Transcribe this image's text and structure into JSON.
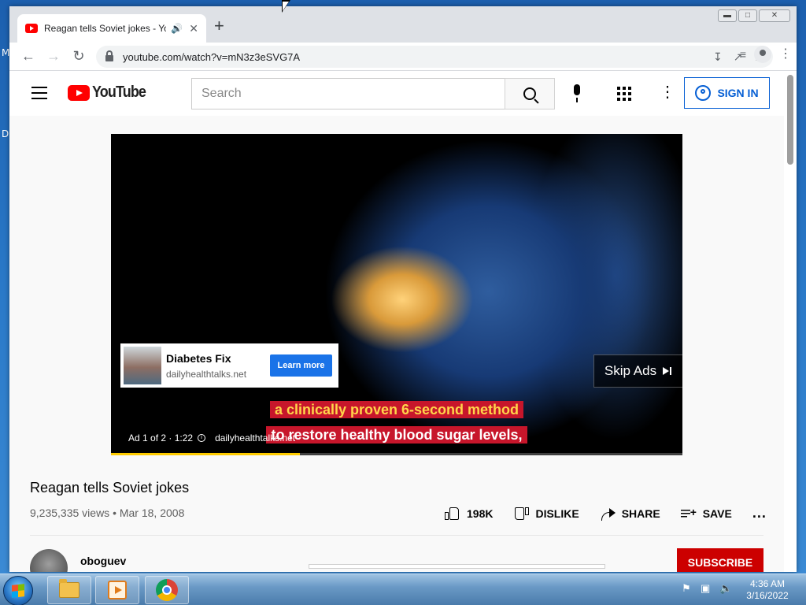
{
  "desktop": {
    "icon_labels": [
      "M",
      "D"
    ]
  },
  "browser": {
    "tab_title": "Reagan tells Soviet jokes - YouTube",
    "new_tab_symbol": "+",
    "url": "youtube.com/watch?v=mN3z3eSVG7A"
  },
  "youtube": {
    "logo_text": "YouTube",
    "search_placeholder": "Search",
    "sign_in_label": "SIGN IN"
  },
  "player": {
    "ad_card": {
      "title": "Diabetes Fix",
      "domain": "dailyhealthtalks.net",
      "cta": "Learn more"
    },
    "skip_label": "Skip Ads",
    "captions": [
      "a clinically proven 6-second method",
      "to restore healthy blood sugar levels,"
    ],
    "ad_position": "Ad 1 of 2 · 1:22",
    "ad_domain": "dailyhealthtalks.net",
    "progress_fraction": 0.33
  },
  "video": {
    "title": "Reagan tells Soviet jokes",
    "meta": "9,235,335 views • Mar 18, 2008",
    "likes": "198K",
    "dislike_label": "DISLIKE",
    "share_label": "SHARE",
    "save_label": "SAVE",
    "more_label": "...",
    "channel_name": "oboguev",
    "subscribe_label": "SUBSCRIBE"
  },
  "taskbar": {
    "time": "4:36 AM",
    "date": "3/16/2022"
  },
  "colors": {
    "youtube_red": "#ff0000",
    "subscribe_red": "#cc0000",
    "link_blue": "#065fd4",
    "learn_more_blue": "#1a73e8",
    "progress_yellow": "#ffcc00",
    "caption_bg": "#c7162b"
  }
}
